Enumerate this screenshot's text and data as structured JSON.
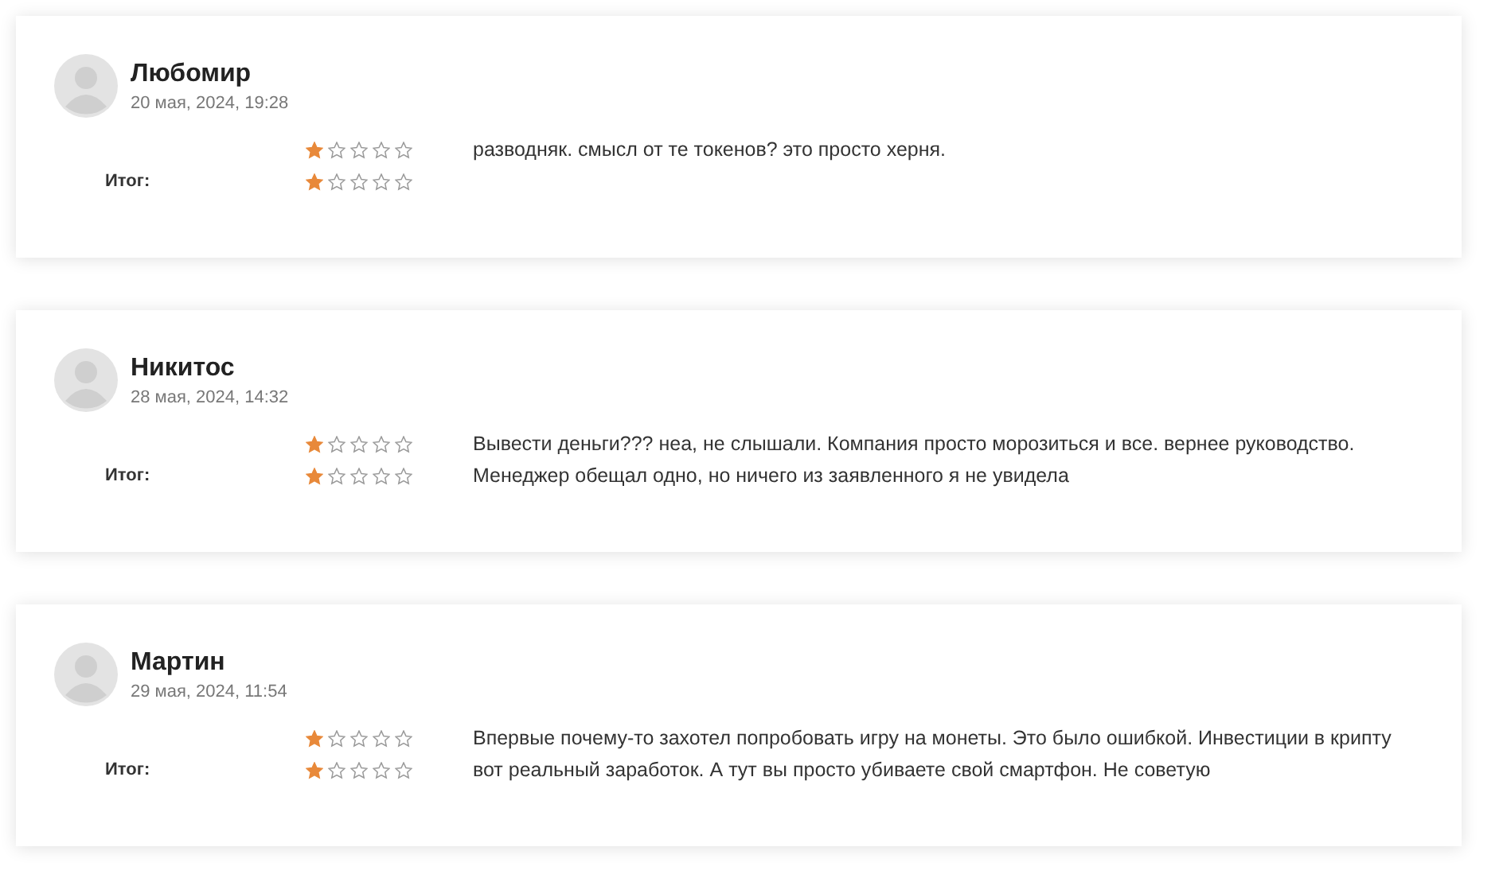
{
  "reviews": [
    {
      "name": "Любомир",
      "date": "20 мая, 2024, 19:28",
      "ratings": [
        {
          "stars": 1
        },
        {
          "label": "Итог:",
          "stars": 1
        }
      ],
      "text": "разводняк. смысл от те токенов? это просто херня."
    },
    {
      "name": "Никитос",
      "date": "28 мая, 2024, 14:32",
      "ratings": [
        {
          "stars": 1
        },
        {
          "label": "Итог:",
          "stars": 1
        }
      ],
      "text": "Вывести деньги??? неа, не слышали. Компания просто морозиться и все. вернее руководство. Менеджер обещал одно, но ничего из заявленного я не увидела"
    },
    {
      "name": "Мартин",
      "date": "29 мая, 2024, 11:54",
      "ratings": [
        {
          "stars": 1
        },
        {
          "label": "Итог:",
          "stars": 1
        }
      ],
      "text": "Впервые почему-то захотел попробовать игру на монеты. Это было ошибкой. Инвестиции в крипту вот реальный заработок. А тут вы просто убиваете свой смартфон. Не советую"
    }
  ]
}
